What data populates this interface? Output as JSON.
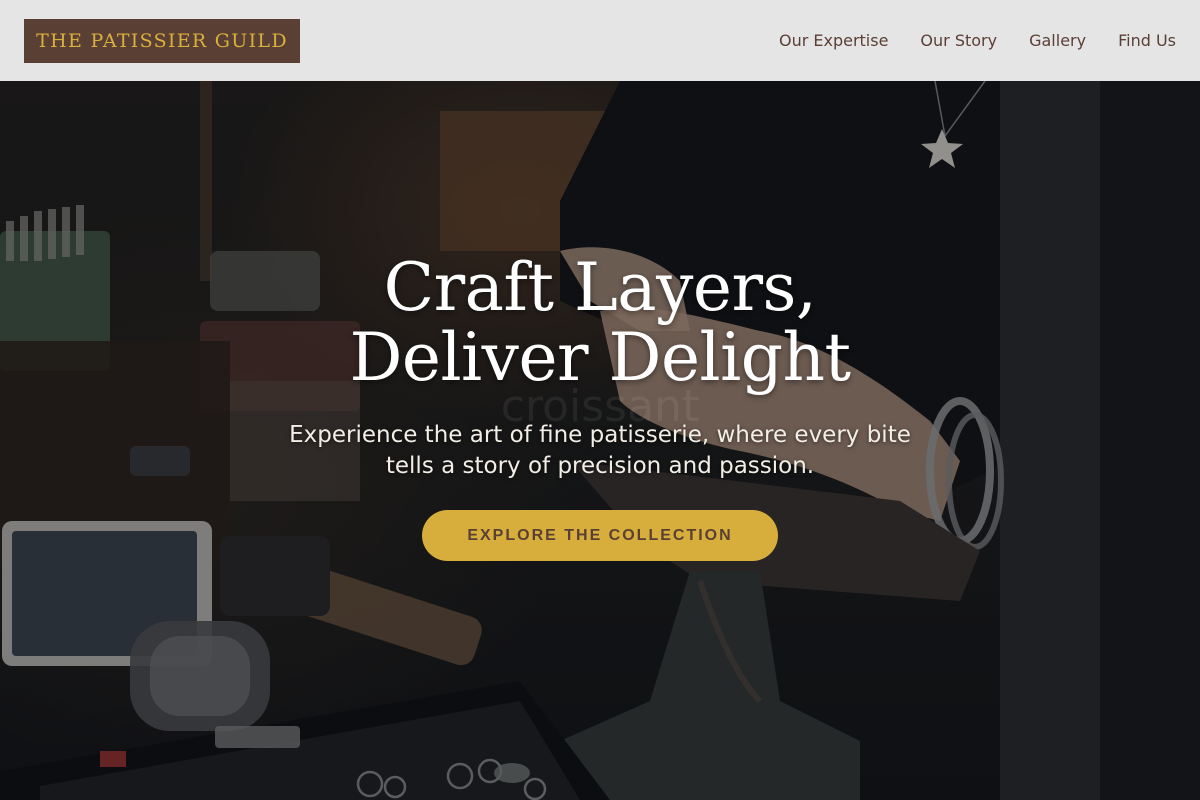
{
  "header": {
    "logo_text": "THE PATISSIER GUILD",
    "nav": [
      {
        "label": "Our Expertise"
      },
      {
        "label": "Our Story"
      },
      {
        "label": "Gallery"
      },
      {
        "label": "Find Us"
      }
    ]
  },
  "hero": {
    "title_line_1": "Craft Layers,",
    "title_line_2": "Deliver Delight",
    "watermark_text": "croissant",
    "subtitle_line_1": "Experience the art of fine patisserie, where every bite",
    "subtitle_line_2": "tells a story of precision and passion.",
    "cta_label": "EXPLORE THE COLLECTION",
    "background_image": "workshop-hands-at-anvil-photo"
  },
  "colors": {
    "brand_brown": "#5a3f34",
    "brand_gold": "#d7ae3c",
    "header_bg": "#ececec"
  }
}
